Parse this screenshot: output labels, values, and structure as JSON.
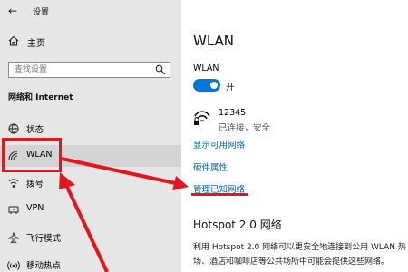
{
  "window": {
    "title": "设置"
  },
  "sidebar": {
    "home_label": "主页",
    "search_placeholder": "查找设置",
    "section_title": "网络和 Internet",
    "items": [
      {
        "label": "状态",
        "icon": "globe-icon"
      },
      {
        "label": "WLAN",
        "icon": "wifi-icon",
        "active": true
      },
      {
        "label": "拨号",
        "icon": "dialup-icon"
      },
      {
        "label": "VPN",
        "icon": "vpn-icon"
      },
      {
        "label": "飞行模式",
        "icon": "airplane-icon"
      },
      {
        "label": "移动热点",
        "icon": "hotspot-icon"
      }
    ]
  },
  "main": {
    "title": "WLAN",
    "wlan_label": "WLAN",
    "toggle_state": "开",
    "toggle_on": true,
    "network": {
      "name": "12345",
      "status": "已连接，安全"
    },
    "links": {
      "show_available": "显示可用网络",
      "hardware_properties": "硬件属性",
      "manage_known": "管理已知网络"
    },
    "hotspot": {
      "title": "Hotspot 2.0 网络",
      "description": "利用 Hotspot 2.0 网络可以更安全地连接到公用 WLAN 热场、酒店和咖啡店等公共场所中可能会提供这些网络。"
    }
  },
  "annotation_color": "#e4161d",
  "accent_color": "#0078d7",
  "link_color": "#0063b1"
}
